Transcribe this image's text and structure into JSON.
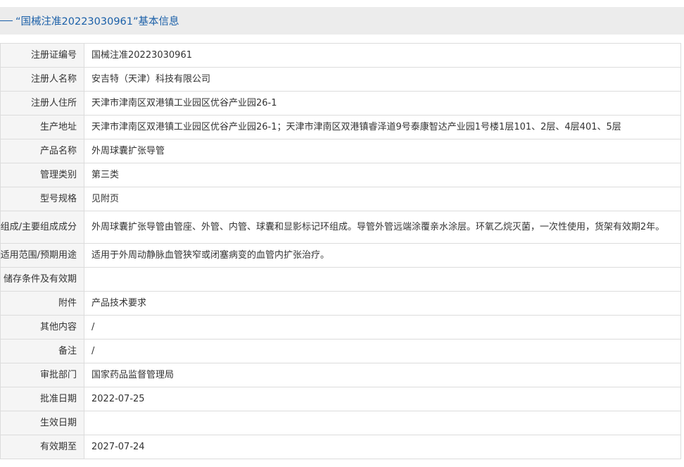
{
  "header": {
    "title": "“国械注准20223030961”基本信息"
  },
  "rows": [
    {
      "label": "注册证编号",
      "value": "国械注准20223030961"
    },
    {
      "label": "注册人名称",
      "value": "安吉特（天津）科技有限公司"
    },
    {
      "label": "注册人住所",
      "value": "天津市津南区双港镇工业园区优谷产业园26-1"
    },
    {
      "label": "生产地址",
      "value": "天津市津南区双港镇工业园区优谷产业园26-1；天津市津南区双港镇睿泽道9号泰康智达产业园1号楼1层101、2层、4层401、5层"
    },
    {
      "label": "产品名称",
      "value": "外周球囊扩张导管"
    },
    {
      "label": "管理类别",
      "value": "第三类"
    },
    {
      "label": "型号规格",
      "value": "见附页"
    },
    {
      "label": "组成/主要组成成分",
      "value": "外周球囊扩张导管由管座、外管、内管、球囊和显影标记环组成。导管外管远端涂覆亲水涂层。环氧乙烷灭菌，一次性使用，货架有效期2年。"
    },
    {
      "label": "适用范围/预期用途",
      "value": "适用于外周动静脉血管狭窄或闭塞病变的血管内扩张治疗。"
    },
    {
      "label": "储存条件及有效期",
      "value": ""
    },
    {
      "label": "附件",
      "value": "产品技术要求"
    },
    {
      "label": "其他内容",
      "value": "/"
    },
    {
      "label": "备注",
      "value": "/"
    },
    {
      "label": "审批部门",
      "value": "国家药品监督管理局"
    },
    {
      "label": "批准日期",
      "value": "2022-07-25"
    },
    {
      "label": "生效日期",
      "value": ""
    },
    {
      "label": "有效期至",
      "value": "2027-07-24"
    }
  ]
}
